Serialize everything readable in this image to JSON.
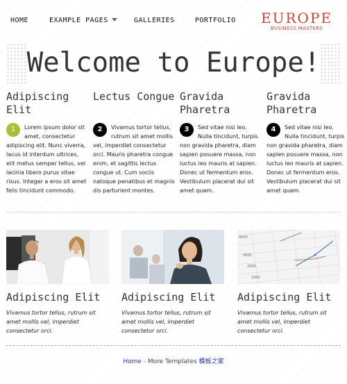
{
  "nav": {
    "items": [
      {
        "label": "HOME"
      },
      {
        "label": "EXAMPLE PAGES"
      },
      {
        "label": "GALLERIES"
      },
      {
        "label": "PORTFOLIO"
      }
    ]
  },
  "logo": {
    "main": "EUROPE",
    "sub": "BUSINESS MASTERS",
    "color": "#c6463a"
  },
  "hero": {
    "title": "Welcome to Europe!"
  },
  "features": [
    {
      "title": "Adipiscing Elit",
      "number": "1",
      "text": "Lorem ipsum dolor sit amet, consectetur adipiscing elit. Nunc viverra, lacus id interdum ultrices, elit metus semper tellus, vel lacinia libero purus vitae risus. Integer a eros sit amet felis tincidunt commodo."
    },
    {
      "title": "Lectus Congue",
      "number": "2",
      "text": "Vivamus tortor tellus, rutrum sit amet mollis vel, imperdiet consectetur orci. Mauris pharetra congue enim, et sagittis lectus congue ut. Cum sociis natoque penatibus et magnis dis parturient montes."
    },
    {
      "title": "Gravida Pharetra",
      "number": "3",
      "text": "Sed vitae nisi leo. Nulla tincidunt, turpis non gravida pharetra, diam sapien posuere massa, non luctus leo mauris at sapien. Donec ut fermentum eros. Vestibulum placerat dui sit amet quam."
    },
    {
      "title": "Gravida Pharetra",
      "number": "4",
      "text": "Sed vitae nisi leo. Nulla tincidunt, turpis non gravida pharetra, diam sapien posuere massa, non luctus leo mauris at sapien. Donec ut fermentum eros. Vestibulum placerat dui sit amet quam."
    }
  ],
  "cards": [
    {
      "title": "Adipiscing Elit",
      "text": "Vivamus tortor tellus, rutrum sit amet mollis vel, imperdiet consectetur orci."
    },
    {
      "title": "Adipiscing Elit",
      "text": "Vivamus tortor tellus, rutrum sit amet mollis vel, imperdiet consectetur orci."
    },
    {
      "title": "Adipiscing Elit",
      "text": "Vivamus tortor tellus, rutrum sit amet mollis vel, imperdiet consectetur orci."
    }
  ],
  "chart_image": {
    "tick_labels": [
      "4000",
      "3000",
      "2000",
      "1000"
    ]
  },
  "footer": {
    "home_link": "Home",
    "separator": " - More Templates ",
    "cn_link": "模板之家"
  },
  "colors": {
    "accent_green": "#a4c13a",
    "link": "#2233bb"
  }
}
